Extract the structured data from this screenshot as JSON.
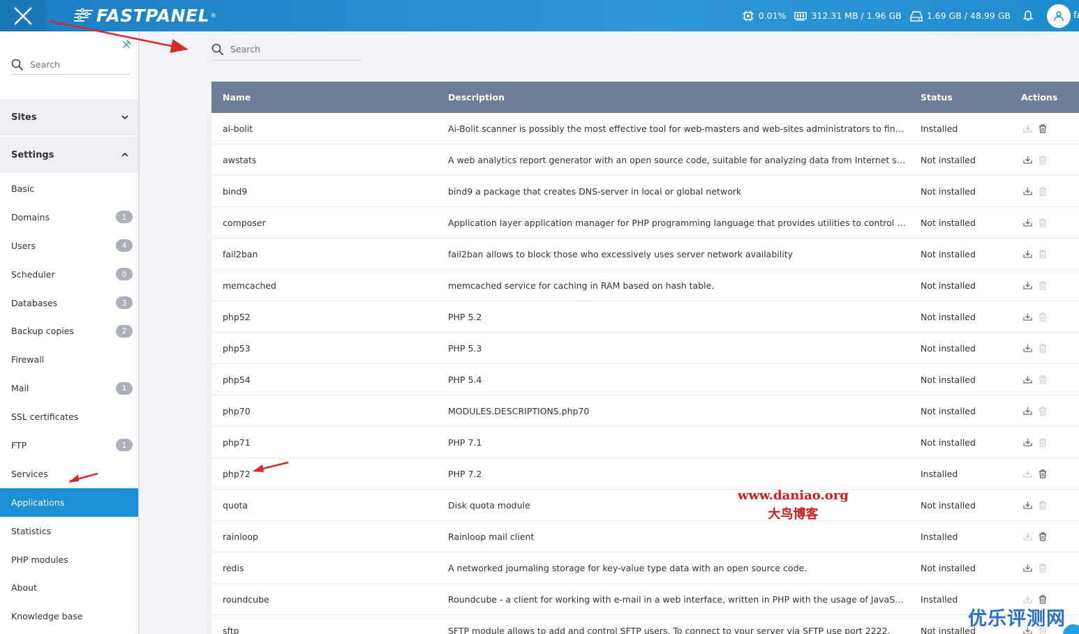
{
  "topbar": {
    "logo": "FASTPANEL",
    "logo_reg": "®",
    "cpu": "0.01%",
    "memory": "312.31 MB / 1.96 GB",
    "disk": "1.69 GB / 48.99 GB",
    "user_initial": "fa"
  },
  "sidebar": {
    "search_placeholder": "Search",
    "sections": {
      "sites": "Sites",
      "settings": "Settings"
    },
    "items": [
      {
        "label": "Basic",
        "badge": ""
      },
      {
        "label": "Domains",
        "badge": "1"
      },
      {
        "label": "Users",
        "badge": "4"
      },
      {
        "label": "Scheduler",
        "badge": "0"
      },
      {
        "label": "Databases",
        "badge": "3"
      },
      {
        "label": "Backup copies",
        "badge": "2"
      },
      {
        "label": "Firewall",
        "badge": ""
      },
      {
        "label": "Mail",
        "badge": "1"
      },
      {
        "label": "SSL certificates",
        "badge": ""
      },
      {
        "label": "FTP",
        "badge": "1"
      },
      {
        "label": "Services",
        "badge": ""
      },
      {
        "label": "Applications",
        "badge": "",
        "active": true
      },
      {
        "label": "Statistics",
        "badge": ""
      },
      {
        "label": "PHP modules",
        "badge": ""
      },
      {
        "label": "About",
        "badge": ""
      },
      {
        "label": "Knowledge base",
        "badge": ""
      }
    ]
  },
  "main": {
    "search_placeholder": "Search",
    "columns": {
      "name": "Name",
      "description": "Description",
      "status": "Status",
      "actions": "Actions"
    },
    "rows": [
      {
        "name": "ai-bolit",
        "description": "Ai-Bolit scanner is possibly the most effective tool for web-masters and web-sites administrators to find viruses a...",
        "status": "Installed"
      },
      {
        "name": "awstats",
        "description": "A web analytics report generator with an open source code, suitable for analyzing data from Internet services, suc...",
        "status": "Not installed"
      },
      {
        "name": "bind9",
        "description": "bind9 a package that creates DNS-server in local or global network",
        "status": "Not installed"
      },
      {
        "name": "composer",
        "description": "Application layer application manager for PHP programming language that provides utilities to control PHP-applic...",
        "status": "Not installed"
      },
      {
        "name": "fail2ban",
        "description": "fail2ban allows to block those who excessively uses server network availability",
        "status": "Not installed"
      },
      {
        "name": "memcached",
        "description": "memcached service for caching in RAM based on hash table.",
        "status": "Not installed"
      },
      {
        "name": "php52",
        "description": "PHP 5.2",
        "status": "Not installed"
      },
      {
        "name": "php53",
        "description": "PHP 5.3",
        "status": "Not installed"
      },
      {
        "name": "php54",
        "description": "PHP 5.4",
        "status": "Not installed"
      },
      {
        "name": "php70",
        "description": "MODULES.DESCRIPTIONS.php70",
        "status": "Not installed"
      },
      {
        "name": "php71",
        "description": "PHP 7.1",
        "status": "Not installed"
      },
      {
        "name": "php72",
        "description": "PHP 7.2",
        "status": "Installed"
      },
      {
        "name": "quota",
        "description": "Disk quota module",
        "status": "Not installed"
      },
      {
        "name": "rainloop",
        "description": "Rainloop mail client",
        "status": "Installed"
      },
      {
        "name": "redis",
        "description": "A networked journaling storage for key-value type data with an open source code.",
        "status": "Not installed"
      },
      {
        "name": "roundcube",
        "description": "Roundcube - a client for working with e-mail in a web interface, written in PHP with the usage of JavaScript, CSS, H...",
        "status": "Installed"
      },
      {
        "name": "sftp",
        "description": "SFTP module allows to add and control SFTP users. To connect to your server via SFTP use port 2222.",
        "status": "Not installed"
      }
    ]
  },
  "overlay": {
    "watermark_url": "www.daniao.org",
    "watermark_name": "大鸟博客",
    "corner_watermark": "优乐评测网"
  },
  "colors": {
    "topbar": "#2e96d6",
    "active": "#1d8fd4",
    "table_header": "#6c7d98",
    "arrow": "#d42a2a"
  }
}
